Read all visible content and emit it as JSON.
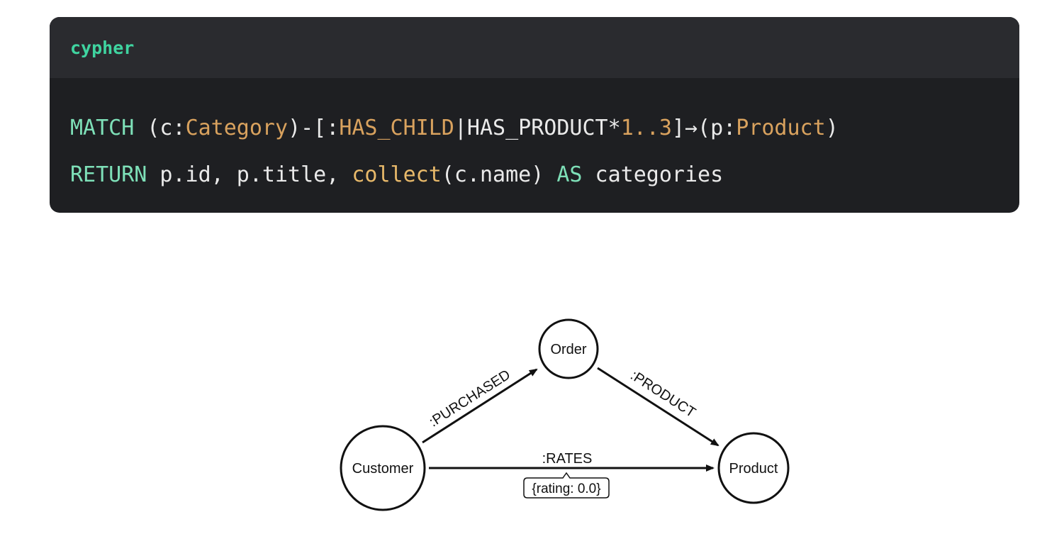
{
  "code_block": {
    "language": "cypher",
    "lines": [
      {
        "tokens": [
          {
            "text": "MATCH",
            "kind": "kw"
          },
          {
            "text": " (c:",
            "kind": "plain"
          },
          {
            "text": "Category",
            "kind": "lbl"
          },
          {
            "text": ")-[:",
            "kind": "plain"
          },
          {
            "text": "HAS_CHILD",
            "kind": "lbl"
          },
          {
            "text": "|HAS_PRODUCT*",
            "kind": "plain"
          },
          {
            "text": "1..3",
            "kind": "lbl"
          },
          {
            "text": "]→(p:",
            "kind": "plain"
          },
          {
            "text": "Product",
            "kind": "lbl"
          },
          {
            "text": ")",
            "kind": "plain"
          }
        ]
      },
      {
        "tokens": [
          {
            "text": "RETURN",
            "kind": "kw"
          },
          {
            "text": " p.id, p.title, ",
            "kind": "plain"
          },
          {
            "text": "collect",
            "kind": "fn"
          },
          {
            "text": "(c.name) ",
            "kind": "plain"
          },
          {
            "text": "AS",
            "kind": "kw"
          },
          {
            "text": " categories",
            "kind": "plain"
          }
        ]
      }
    ]
  },
  "graph": {
    "nodes": {
      "order": "Order",
      "customer": "Customer",
      "product": "Product"
    },
    "edges": {
      "purchased": ":PURCHASED",
      "product": ":PRODUCT",
      "rates": ":RATES",
      "rates_props": "{rating: 0.0}"
    }
  }
}
